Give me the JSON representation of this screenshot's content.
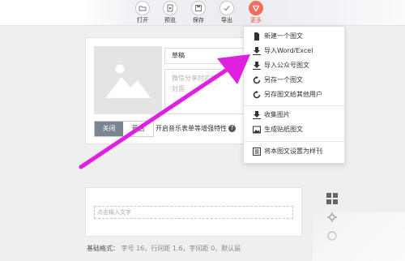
{
  "toolbar": {
    "buttons": [
      {
        "label": "打开",
        "icon": "folder-icon"
      },
      {
        "label": "预览",
        "icon": "preview-icon"
      },
      {
        "label": "保存",
        "icon": "save-icon"
      },
      {
        "label": "导出",
        "icon": "export-icon"
      },
      {
        "label": "更多",
        "icon": "more-triangle-icon",
        "active": true
      }
    ]
  },
  "editor": {
    "title_value": "草稿",
    "summary_placeholder": "微信分享时的摘",
    "cover_label": "封面",
    "music_toggle": {
      "off_label": "关闭",
      "on_label": "开启",
      "selected": "off"
    },
    "music_hint": "开启音乐表单等增强特性"
  },
  "content": {
    "input_placeholder": "点击输入文字",
    "format_bar": {
      "label": "基础格式：",
      "values": "字号 16，行间距 1.6，字间距 0，默认届"
    }
  },
  "more_menu": {
    "items": [
      {
        "label": "新建一个图文",
        "icon": "new-doc-icon"
      },
      {
        "label": "导入Word/Excel",
        "icon": "import-icon"
      },
      {
        "label": "导入公众号图文",
        "icon": "import-icon"
      },
      {
        "label": "另存一个图文",
        "icon": "save-as-icon"
      },
      {
        "label": "另存图文给其他用户",
        "icon": "share-icon"
      },
      {
        "label": "收集图片",
        "icon": "collect-images-icon"
      },
      {
        "label": "生成贴纸图文",
        "icon": "image-icon"
      },
      {
        "label": "将本图文设置为样刊",
        "icon": "template-icon"
      }
    ]
  },
  "colors": {
    "accent": "#f26d5e",
    "annotation_arrow": "#e020e0",
    "toggle_selected": "#7a8591"
  }
}
